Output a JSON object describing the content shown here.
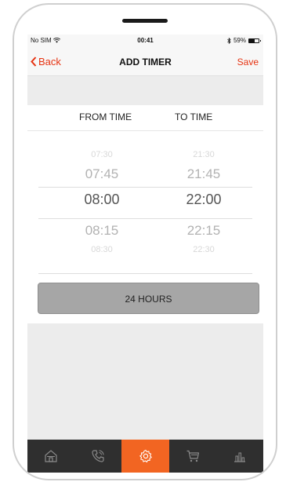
{
  "status_bar": {
    "carrier": "No SIM",
    "time": "00:41",
    "battery_percent": "59%"
  },
  "nav": {
    "back_label": "Back",
    "title": "ADD TIMER",
    "save_label": "Save"
  },
  "picker": {
    "from_header": "FROM TIME",
    "to_header": "TO TIME",
    "from_values": [
      "07:30",
      "07:45",
      "08:00",
      "08:15",
      "08:30"
    ],
    "to_values": [
      "21:30",
      "21:45",
      "22:00",
      "22:15",
      "22:30"
    ]
  },
  "hours_button_label": "24 HOURS",
  "tabbar": {
    "items": [
      "home-icon",
      "phone-icon",
      "settings-icon",
      "cart-icon",
      "chart-icon"
    ],
    "active_index": 2
  },
  "colors": {
    "accent": "#e63312",
    "tab_active": "#f26522",
    "tab_bg": "#2f2f2f"
  }
}
